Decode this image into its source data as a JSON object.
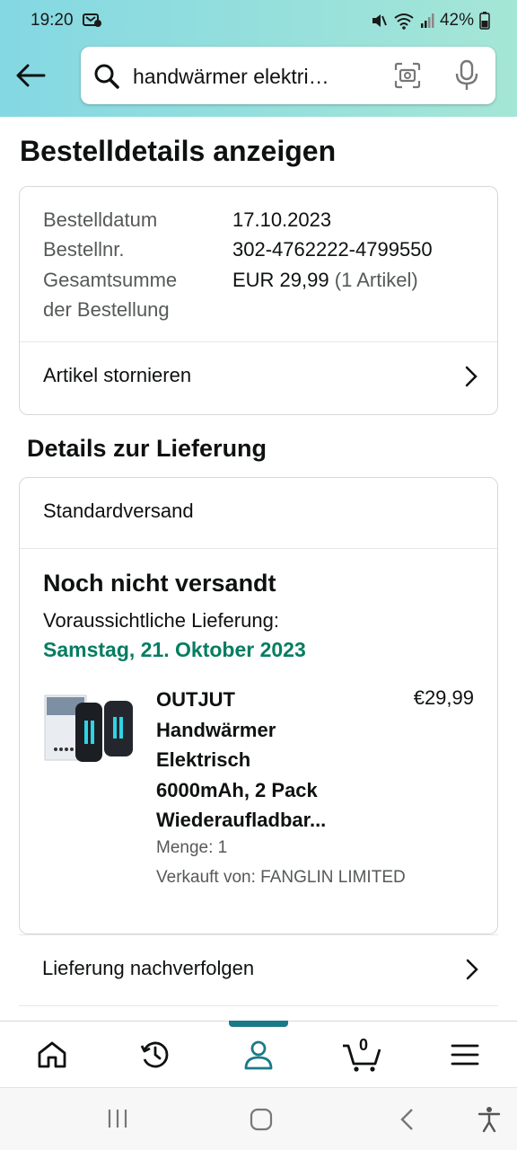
{
  "status_bar": {
    "time": "19:20",
    "battery": "42%"
  },
  "search": {
    "query": "handwärmer elektri…"
  },
  "page_title": "Bestelldetails anzeigen",
  "order_summary": {
    "rows": [
      {
        "label": "Bestelldatum",
        "value": "17.10.2023"
      },
      {
        "label": "Bestellnr.",
        "value": "302-4762222-4799550"
      }
    ],
    "total_label_line1": "Gesamtsumme",
    "total_label_line2": "der Bestellung",
    "total_value": "EUR 29,99",
    "total_items": "(1 Artikel)",
    "cancel_link": "Artikel stornieren"
  },
  "delivery": {
    "section_title": "Details zur Lieferung",
    "shipping_method": "Standardversand",
    "status": "Noch nicht versandt",
    "eta_label": "Voraussichtliche Lieferung:",
    "eta_date": "Samstag, 21. Oktober 2023",
    "item": {
      "name_lines": [
        "OUTJUT",
        "Handwärmer",
        "Elektrisch",
        "6000mAh, 2 Pack",
        "Wiederaufladbar..."
      ],
      "price": "€29,99",
      "quantity": "Menge: 1",
      "seller": "Verkauft von: FANGLIN LIMITED"
    },
    "track_link": "Lieferung nachverfolgen"
  },
  "bottom_nav": {
    "items": [
      "home-icon",
      "orders-history-icon",
      "account-icon",
      "cart-icon",
      "menu-icon"
    ],
    "cart_count": "0",
    "active": "account-icon",
    "accent_color": "#1a7a87"
  },
  "colors": {
    "header_gradient_start": "#84d8e3",
    "header_gradient_end": "#a5e6d6",
    "eta_green": "#067d62"
  }
}
